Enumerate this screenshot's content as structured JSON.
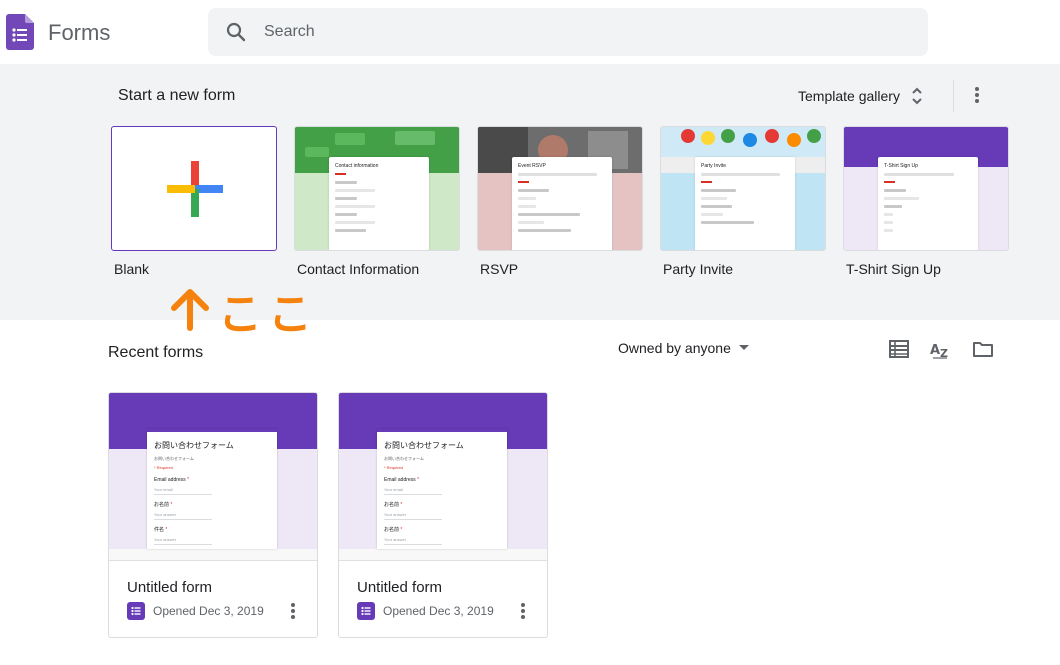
{
  "header": {
    "app_title": "Forms",
    "search_placeholder": "Search"
  },
  "templates": {
    "section_title": "Start a new form",
    "gallery_label": "Template gallery",
    "items": [
      {
        "label": "Blank"
      },
      {
        "label": "Contact Information",
        "mini_title": "Contact information"
      },
      {
        "label": "RSVP",
        "mini_title": "Event RSVP"
      },
      {
        "label": "Party Invite",
        "mini_title": "Party Invite"
      },
      {
        "label": "T-Shirt Sign Up",
        "mini_title": "T-Shirt Sign Up"
      }
    ]
  },
  "annotation": {
    "text": "ここ"
  },
  "recent": {
    "section_title": "Recent forms",
    "owner_filter": "Owned by anyone",
    "cards": [
      {
        "title": "Untitled form",
        "opened": "Opened Dec 3, 2019",
        "thumb": {
          "doc_title": "お問い合わせフォーム",
          "doc_desc": "お問い合わせフォーム",
          "required": "* Required",
          "questions": [
            {
              "label": "Email address",
              "answer": "Your email"
            },
            {
              "label": "お名前",
              "answer": "Your answer"
            },
            {
              "label": "件名",
              "answer": "Your answer"
            }
          ]
        }
      },
      {
        "title": "Untitled form",
        "opened": "Opened Dec 3, 2019",
        "thumb": {
          "doc_title": "お問い合わせフォーム",
          "doc_desc": "お問い合わせフォーム",
          "required": "* Required",
          "questions": [
            {
              "label": "Email address",
              "answer": "Your email"
            },
            {
              "label": "お名前",
              "answer": "Your answer"
            },
            {
              "label": "お名前",
              "answer": "Your answer"
            }
          ]
        }
      }
    ]
  },
  "colors": {
    "brand_purple": "#673ab7",
    "annotation_orange": "#f5820c",
    "section_bg": "#f1f3f4"
  }
}
